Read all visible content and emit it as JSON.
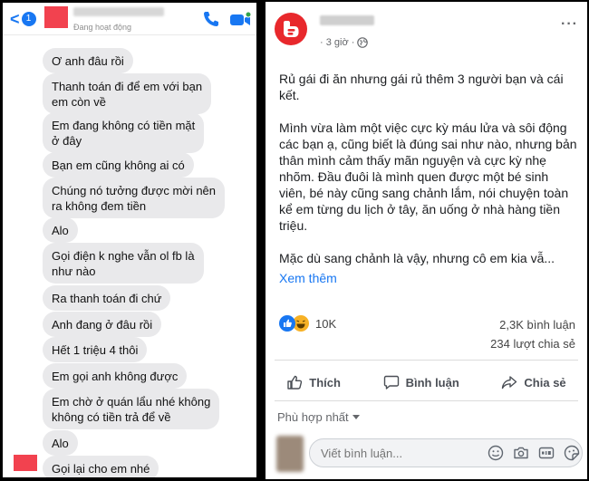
{
  "chat": {
    "back_count": "1",
    "status": "Đang hoạt động",
    "messages": [
      "Ơ anh đâu rồi",
      "Thanh toán đi để em với bạn",
      "em còn về",
      "Em đang không có tiền mặt",
      "ở đây",
      "Bạn em cũng không ai có",
      "Chúng nó tưởng được mời nên",
      "ra không đem tiền",
      "Alo",
      "Gọi điện k nghe vẫn ol fb là",
      "như nào",
      "Ra thanh toán đi chứ",
      "Anh đang ở đâu rồi",
      "Hết 1 triệu 4 thôi",
      "Em gọi anh không được",
      "Em chờ ở quán lẩu nhé không",
      "không có tiền trả để về",
      "Alo",
      "Gọi lại cho em nhé"
    ],
    "colors": {
      "accent": "#1877f2",
      "bubble": "#e9e9eb",
      "redacted": "#f2424f"
    }
  },
  "post": {
    "time": "· 3 giờ ·",
    "more": "···",
    "paragraph1": "Rủ gái đi ăn nhưng gái rủ thêm 3 người bạn và cái kết.",
    "paragraph2": "Mình vừa làm một việc cực kỳ máu lửa và sôi động các bạn ạ, cũng biết là đúng sai như nào, nhưng bản thân mình cảm thấy mãn nguyện và cực kỳ nhẹ nhõm. Đầu đuôi là mình quen được một bé sinh viên, bé này cũng sang chảnh lắm, nói chuyện toàn kể em từng du lịch ở tây, ăn uống ở nhà hàng tiền triệu.",
    "paragraph3": "Mặc dù sang chảnh là vậy, nhưng cô em kia vẫ...",
    "see_more": "Xem thêm",
    "reaction_count": "10K",
    "comment_count": "2,3K bình luận",
    "share_count": "234 lượt chia sẻ",
    "actions": {
      "like": "Thích",
      "comment": "Bình luận",
      "share": "Chia sẻ"
    },
    "sort_label": "Phù hợp nhất",
    "comment_placeholder": "Viết bình luận...",
    "icons": [
      "emoji-icon",
      "camera-icon",
      "gif-icon",
      "sticker-icon"
    ],
    "colors": {
      "link": "#1877f2",
      "logo": "#e8282c",
      "like": "#1877f2",
      "haha": "#f7b125"
    }
  }
}
